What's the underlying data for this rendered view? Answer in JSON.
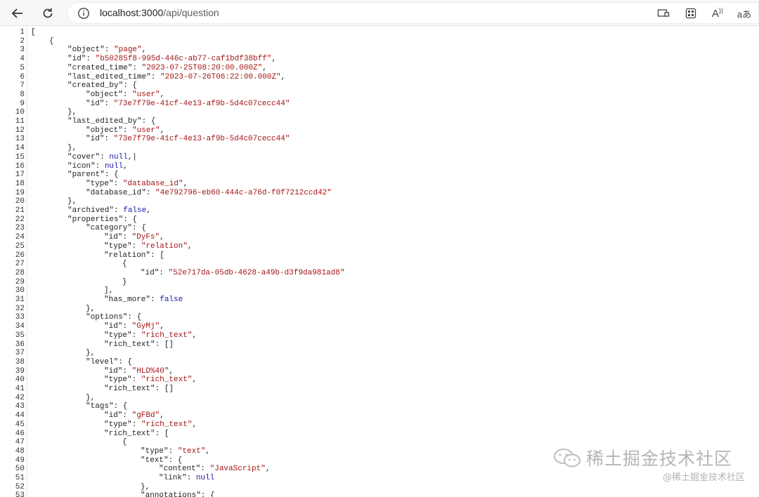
{
  "browser": {
    "url_host": "localhost:3000",
    "url_path": "/api/question",
    "right_icons": [
      "reader-mode-icon",
      "apps-icon",
      "read-aloud-icon",
      "translate-icon"
    ],
    "read_aloud_glyph": "A",
    "translate_glyph": "aあ"
  },
  "watermark": {
    "text": "稀土掘金技术社区",
    "handle": "@稀土掘金技术社区"
  },
  "json_lines": [
    {
      "n": "1",
      "i": 0,
      "t": [
        [
          "p",
          "["
        ]
      ]
    },
    {
      "n": "2",
      "i": 1,
      "t": [
        [
          "p",
          "{"
        ]
      ]
    },
    {
      "n": "3",
      "i": 2,
      "t": [
        [
          "k",
          "\"object\""
        ],
        [
          "p",
          ": "
        ],
        [
          "s",
          "\"page\""
        ],
        [
          "p",
          ","
        ]
      ]
    },
    {
      "n": "4",
      "i": 2,
      "t": [
        [
          "k",
          "\"id\""
        ],
        [
          "p",
          ": "
        ],
        [
          "s",
          "\"b50285f8-995d-446c-ab77-caf1bdf38bff\""
        ],
        [
          "p",
          ","
        ]
      ]
    },
    {
      "n": "5",
      "i": 2,
      "t": [
        [
          "k",
          "\"created_time\""
        ],
        [
          "p",
          ": "
        ],
        [
          "s",
          "\"2023-07-25T08:20:00.000Z\""
        ],
        [
          "p",
          ","
        ]
      ]
    },
    {
      "n": "6",
      "i": 2,
      "t": [
        [
          "k",
          "\"last_edited_time\""
        ],
        [
          "p",
          ": "
        ],
        [
          "s",
          "\"2023-07-26T06:22:00.000Z\""
        ],
        [
          "p",
          ","
        ]
      ]
    },
    {
      "n": "7",
      "i": 2,
      "t": [
        [
          "k",
          "\"created_by\""
        ],
        [
          "p",
          ": {"
        ]
      ]
    },
    {
      "n": "8",
      "i": 3,
      "t": [
        [
          "k",
          "\"object\""
        ],
        [
          "p",
          ": "
        ],
        [
          "s",
          "\"user\""
        ],
        [
          "p",
          ","
        ]
      ]
    },
    {
      "n": "9",
      "i": 3,
      "t": [
        [
          "k",
          "\"id\""
        ],
        [
          "p",
          ": "
        ],
        [
          "s",
          "\"73e7f79e-41cf-4e13-af9b-5d4c07cecc44\""
        ]
      ]
    },
    {
      "n": "10",
      "i": 2,
      "t": [
        [
          "p",
          "},"
        ]
      ]
    },
    {
      "n": "11",
      "i": 2,
      "t": [
        [
          "k",
          "\"last_edited_by\""
        ],
        [
          "p",
          ": {"
        ]
      ]
    },
    {
      "n": "12",
      "i": 3,
      "t": [
        [
          "k",
          "\"object\""
        ],
        [
          "p",
          ": "
        ],
        [
          "s",
          "\"user\""
        ],
        [
          "p",
          ","
        ]
      ]
    },
    {
      "n": "13",
      "i": 3,
      "t": [
        [
          "k",
          "\"id\""
        ],
        [
          "p",
          ": "
        ],
        [
          "s",
          "\"73e7f79e-41cf-4e13-af9b-5d4c07cecc44\""
        ]
      ]
    },
    {
      "n": "14",
      "i": 2,
      "t": [
        [
          "p",
          "},"
        ]
      ]
    },
    {
      "n": "15",
      "i": 2,
      "t": [
        [
          "k",
          "\"cover\""
        ],
        [
          "p",
          ": "
        ],
        [
          "n",
          "null"
        ],
        [
          "p",
          ",|"
        ]
      ]
    },
    {
      "n": "16",
      "i": 2,
      "t": [
        [
          "k",
          "\"icon\""
        ],
        [
          "p",
          ": "
        ],
        [
          "n",
          "null"
        ],
        [
          "p",
          ","
        ]
      ]
    },
    {
      "n": "17",
      "i": 2,
      "t": [
        [
          "k",
          "\"parent\""
        ],
        [
          "p",
          ": {"
        ]
      ]
    },
    {
      "n": "18",
      "i": 3,
      "t": [
        [
          "k",
          "\"type\""
        ],
        [
          "p",
          ": "
        ],
        [
          "s",
          "\"database_id\""
        ],
        [
          "p",
          ","
        ]
      ]
    },
    {
      "n": "19",
      "i": 3,
      "t": [
        [
          "k",
          "\"database_id\""
        ],
        [
          "p",
          ": "
        ],
        [
          "s",
          "\"4e792796-eb60-444c-a76d-f0f7212ccd42\""
        ]
      ]
    },
    {
      "n": "20",
      "i": 2,
      "t": [
        [
          "p",
          "},"
        ]
      ]
    },
    {
      "n": "21",
      "i": 2,
      "t": [
        [
          "k",
          "\"archived\""
        ],
        [
          "p",
          ": "
        ],
        [
          "n",
          "false"
        ],
        [
          "p",
          ","
        ]
      ]
    },
    {
      "n": "22",
      "i": 2,
      "t": [
        [
          "k",
          "\"properties\""
        ],
        [
          "p",
          ": {"
        ]
      ]
    },
    {
      "n": "23",
      "i": 3,
      "t": [
        [
          "k",
          "\"category\""
        ],
        [
          "p",
          ": {"
        ]
      ]
    },
    {
      "n": "24",
      "i": 4,
      "t": [
        [
          "k",
          "\"id\""
        ],
        [
          "p",
          ": "
        ],
        [
          "s",
          "\"DyFs\""
        ],
        [
          "p",
          ","
        ]
      ]
    },
    {
      "n": "25",
      "i": 4,
      "t": [
        [
          "k",
          "\"type\""
        ],
        [
          "p",
          ": "
        ],
        [
          "s",
          "\"relation\""
        ],
        [
          "p",
          ","
        ]
      ]
    },
    {
      "n": "26",
      "i": 4,
      "t": [
        [
          "k",
          "\"relation\""
        ],
        [
          "p",
          ": ["
        ]
      ]
    },
    {
      "n": "27",
      "i": 5,
      "t": [
        [
          "p",
          "{"
        ]
      ]
    },
    {
      "n": "28",
      "i": 6,
      "t": [
        [
          "k",
          "\"id\""
        ],
        [
          "p",
          ": "
        ],
        [
          "s",
          "\"52e717da-05db-4628-a49b-d3f9da981ad8\""
        ]
      ]
    },
    {
      "n": "29",
      "i": 5,
      "t": [
        [
          "p",
          "}"
        ]
      ]
    },
    {
      "n": "30",
      "i": 4,
      "t": [
        [
          "p",
          "],"
        ]
      ]
    },
    {
      "n": "31",
      "i": 4,
      "t": [
        [
          "k",
          "\"has_more\""
        ],
        [
          "p",
          ": "
        ],
        [
          "n",
          "false"
        ]
      ]
    },
    {
      "n": "32",
      "i": 3,
      "t": [
        [
          "p",
          "},"
        ]
      ]
    },
    {
      "n": "33",
      "i": 3,
      "t": [
        [
          "k",
          "\"options\""
        ],
        [
          "p",
          ": {"
        ]
      ]
    },
    {
      "n": "34",
      "i": 4,
      "t": [
        [
          "k",
          "\"id\""
        ],
        [
          "p",
          ": "
        ],
        [
          "s",
          "\"GyMj\""
        ],
        [
          "p",
          ","
        ]
      ]
    },
    {
      "n": "35",
      "i": 4,
      "t": [
        [
          "k",
          "\"type\""
        ],
        [
          "p",
          ": "
        ],
        [
          "s",
          "\"rich_text\""
        ],
        [
          "p",
          ","
        ]
      ]
    },
    {
      "n": "36",
      "i": 4,
      "t": [
        [
          "k",
          "\"rich_text\""
        ],
        [
          "p",
          ": []"
        ]
      ]
    },
    {
      "n": "37",
      "i": 3,
      "t": [
        [
          "p",
          "},"
        ]
      ]
    },
    {
      "n": "38",
      "i": 3,
      "t": [
        [
          "k",
          "\"level\""
        ],
        [
          "p",
          ": {"
        ]
      ]
    },
    {
      "n": "39",
      "i": 4,
      "t": [
        [
          "k",
          "\"id\""
        ],
        [
          "p",
          ": "
        ],
        [
          "s",
          "\"HLD%40\""
        ],
        [
          "p",
          ","
        ]
      ]
    },
    {
      "n": "40",
      "i": 4,
      "t": [
        [
          "k",
          "\"type\""
        ],
        [
          "p",
          ": "
        ],
        [
          "s",
          "\"rich_text\""
        ],
        [
          "p",
          ","
        ]
      ]
    },
    {
      "n": "41",
      "i": 4,
      "t": [
        [
          "k",
          "\"rich_text\""
        ],
        [
          "p",
          ": []"
        ]
      ]
    },
    {
      "n": "42",
      "i": 3,
      "t": [
        [
          "p",
          "},"
        ]
      ]
    },
    {
      "n": "43",
      "i": 3,
      "t": [
        [
          "k",
          "\"tags\""
        ],
        [
          "p",
          ": {"
        ]
      ]
    },
    {
      "n": "44",
      "i": 4,
      "t": [
        [
          "k",
          "\"id\""
        ],
        [
          "p",
          ": "
        ],
        [
          "s",
          "\"gFBd\""
        ],
        [
          "p",
          ","
        ]
      ]
    },
    {
      "n": "45",
      "i": 4,
      "t": [
        [
          "k",
          "\"type\""
        ],
        [
          "p",
          ": "
        ],
        [
          "s",
          "\"rich_text\""
        ],
        [
          "p",
          ","
        ]
      ]
    },
    {
      "n": "46",
      "i": 4,
      "t": [
        [
          "k",
          "\"rich_text\""
        ],
        [
          "p",
          ": ["
        ]
      ]
    },
    {
      "n": "47",
      "i": 5,
      "t": [
        [
          "p",
          "{"
        ]
      ]
    },
    {
      "n": "48",
      "i": 6,
      "t": [
        [
          "k",
          "\"type\""
        ],
        [
          "p",
          ": "
        ],
        [
          "s",
          "\"text\""
        ],
        [
          "p",
          ","
        ]
      ]
    },
    {
      "n": "49",
      "i": 6,
      "t": [
        [
          "k",
          "\"text\""
        ],
        [
          "p",
          ": {"
        ]
      ]
    },
    {
      "n": "50",
      "i": 7,
      "t": [
        [
          "k",
          "\"content\""
        ],
        [
          "p",
          ": "
        ],
        [
          "s",
          "\"JavaScript\""
        ],
        [
          "p",
          ","
        ]
      ]
    },
    {
      "n": "51",
      "i": 7,
      "t": [
        [
          "k",
          "\"link\""
        ],
        [
          "p",
          ": "
        ],
        [
          "n",
          "null"
        ]
      ]
    },
    {
      "n": "52",
      "i": 6,
      "t": [
        [
          "p",
          "},"
        ]
      ]
    },
    {
      "n": "53",
      "i": 6,
      "t": [
        [
          "k",
          "\"annotations\""
        ],
        [
          "p",
          ": {"
        ]
      ]
    }
  ]
}
